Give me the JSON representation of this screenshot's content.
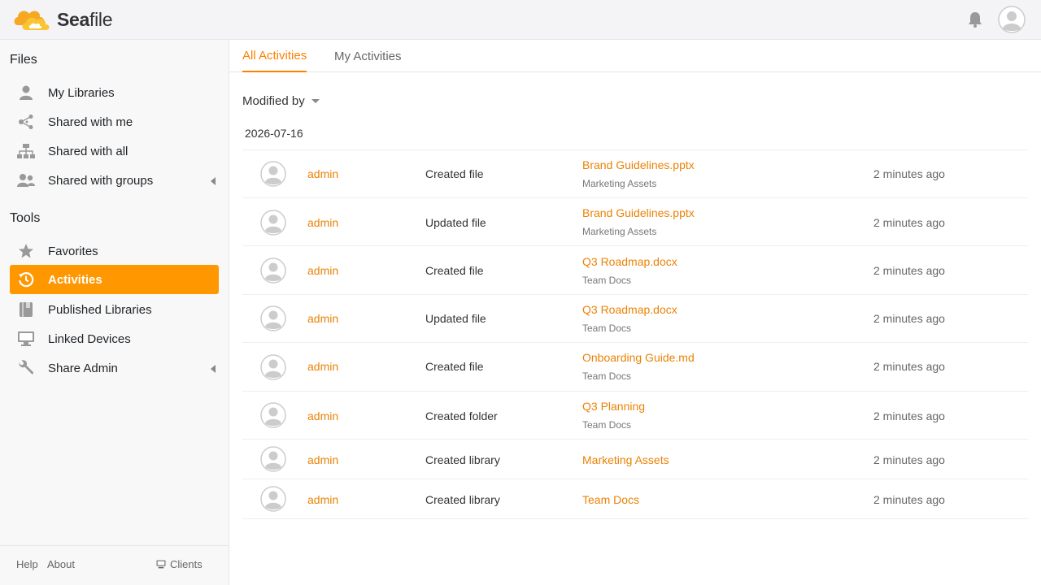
{
  "app": {
    "logo_text_bold": "Sea",
    "logo_text_light": "file",
    "accent": "#ff9800",
    "link_color": "#eb8205"
  },
  "sidebar": {
    "files_heading": "Files",
    "tools_heading": "Tools",
    "files_items": [
      {
        "label": "My Libraries",
        "icon": "user-icon"
      },
      {
        "label": "Shared with me",
        "icon": "share-icon"
      },
      {
        "label": "Shared with all",
        "icon": "org-icon"
      },
      {
        "label": "Shared with groups",
        "icon": "group-icon"
      }
    ],
    "tools_items": [
      {
        "label": "Favorites",
        "icon": "star-icon"
      },
      {
        "label": "Activities",
        "icon": "history-icon"
      },
      {
        "label": "Published Libraries",
        "icon": "book-icon"
      },
      {
        "label": "Linked Devices",
        "icon": "monitor-icon"
      },
      {
        "label": "Share Admin",
        "icon": "wrench-icon"
      }
    ],
    "footer": {
      "help": "Help",
      "about": "About",
      "clients": "Clients"
    }
  },
  "main": {
    "tabs": [
      {
        "label": "All Activities",
        "active": true
      },
      {
        "label": "My Activities",
        "active": false
      }
    ],
    "filter_label": "Modified by",
    "date": "2026-07-16",
    "rows": [
      {
        "user": "admin",
        "op": "Created file",
        "name": "Brand Guidelines.pptx",
        "lib": "Marketing Assets",
        "time": "2 minutes ago"
      },
      {
        "user": "admin",
        "op": "Updated file",
        "name": "Brand Guidelines.pptx",
        "lib": "Marketing Assets",
        "time": "2 minutes ago"
      },
      {
        "user": "admin",
        "op": "Created file",
        "name": "Q3 Roadmap.docx",
        "lib": "Team Docs",
        "time": "2 minutes ago"
      },
      {
        "user": "admin",
        "op": "Updated file",
        "name": "Q3 Roadmap.docx",
        "lib": "Team Docs",
        "time": "2 minutes ago"
      },
      {
        "user": "admin",
        "op": "Created file",
        "name": "Onboarding Guide.md",
        "lib": "Team Docs",
        "time": "2 minutes ago"
      },
      {
        "user": "admin",
        "op": "Created folder",
        "name": "Q3 Planning",
        "lib": "Team Docs",
        "time": "2 minutes ago"
      },
      {
        "user": "admin",
        "op": "Created library",
        "name": "Marketing Assets",
        "lib": "",
        "time": "2 minutes ago"
      },
      {
        "user": "admin",
        "op": "Created library",
        "name": "Team Docs",
        "lib": "",
        "time": "2 minutes ago"
      }
    ]
  }
}
